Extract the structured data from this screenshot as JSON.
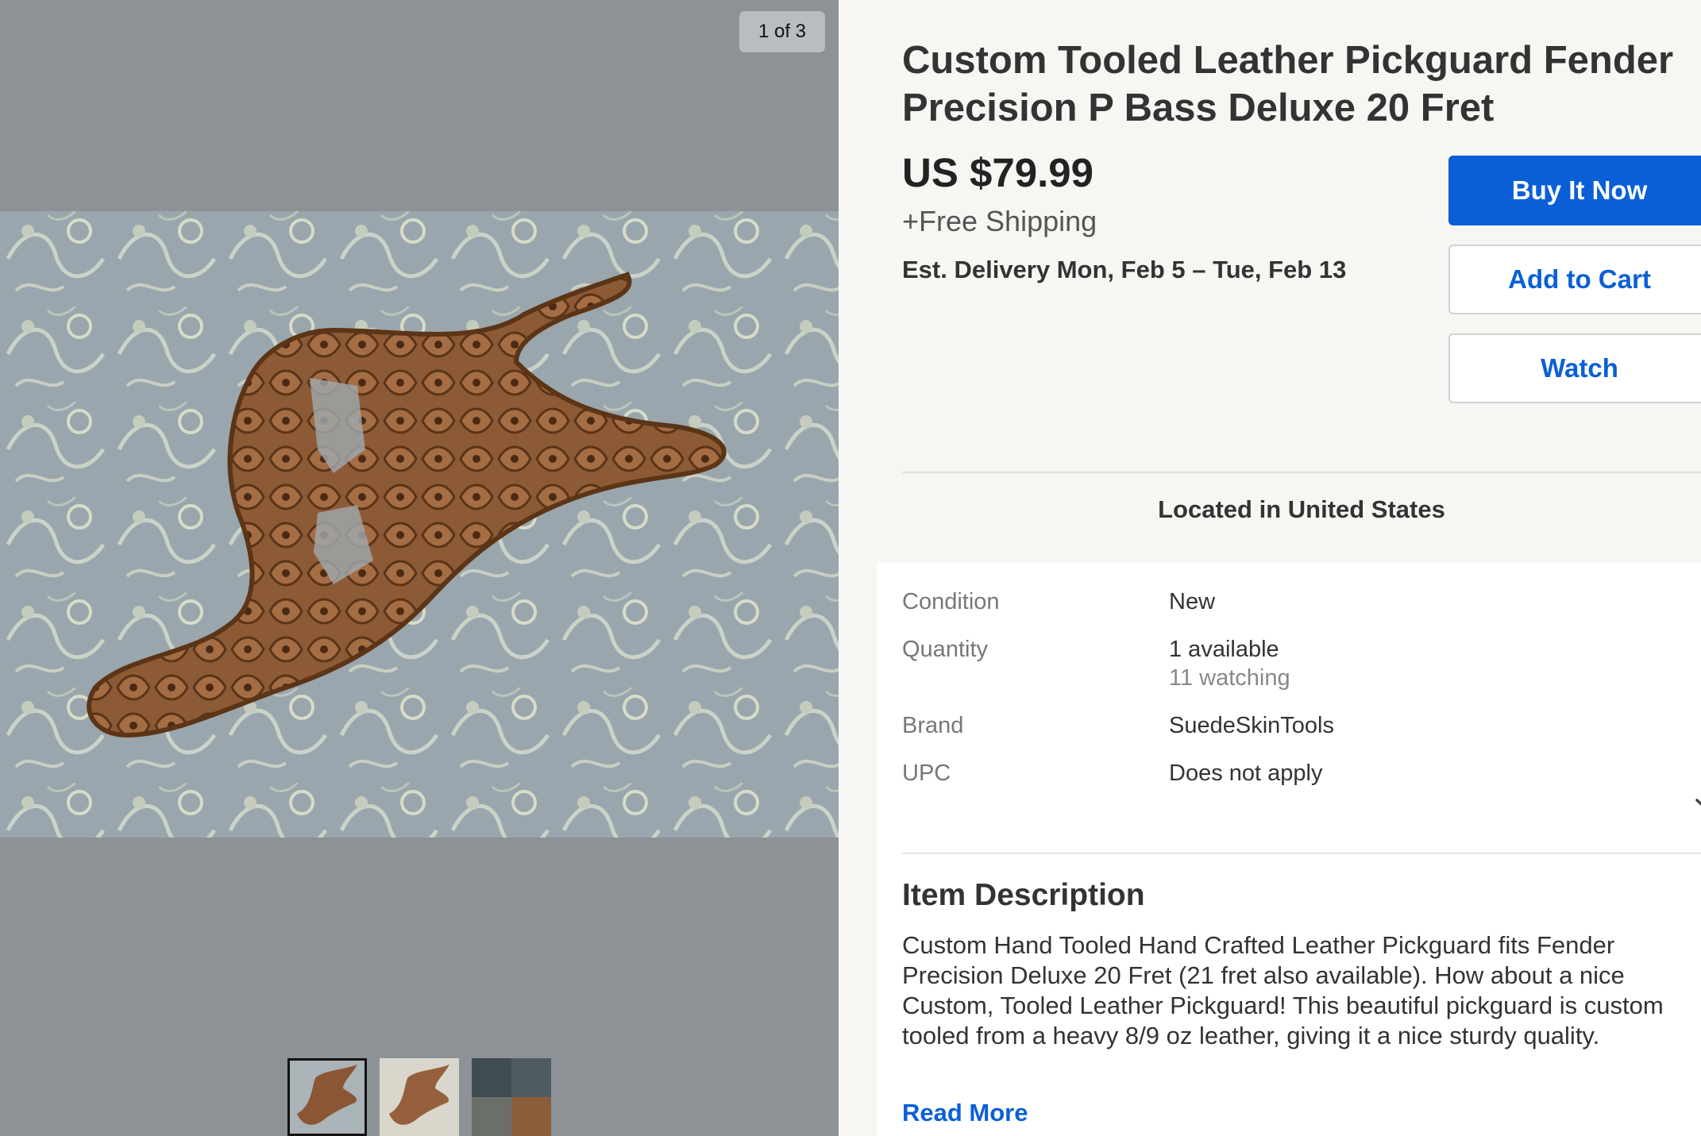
{
  "gallery": {
    "counter": "1 of 3",
    "thumbnail_count": 3,
    "active_thumbnail": 1,
    "background_color": "#8d9297"
  },
  "listing": {
    "title": "Custom Tooled Leather Pickguard Fender Precision P Bass Deluxe 20 Fret",
    "price": "US $79.99",
    "shipping": "+Free Shipping",
    "delivery": "Est. Delivery Mon, Feb 5 – Tue, Feb 13",
    "location": "Located in United States"
  },
  "actions": {
    "buy_label": "Buy It Now",
    "cart_label": "Add to Cart",
    "watch_label": "Watch"
  },
  "details": {
    "condition_label": "Condition",
    "condition_value": "New",
    "quantity_label": "Quantity",
    "quantity_value": "1 available",
    "watching": "11 watching",
    "brand_label": "Brand",
    "brand_value": "SuedeSkinTools",
    "upc_label": "UPC",
    "upc_value": "Does not apply",
    "expand_icon": "chevron-down-icon"
  },
  "description": {
    "heading": "Item Description",
    "text": "Custom Hand Tooled Hand Crafted Leather Pickguard fits Fender Precision Deluxe 20 Fret (21 fret also available). How about a nice Custom, Tooled Leather Pickguard! This beautiful pickguard is custom tooled from a heavy 8/9 oz leather, giving it a nice sturdy quality.",
    "read_more": "Read More"
  },
  "colors": {
    "accent": "#0a5fd6",
    "panel_bg": "#f7f6f3"
  }
}
